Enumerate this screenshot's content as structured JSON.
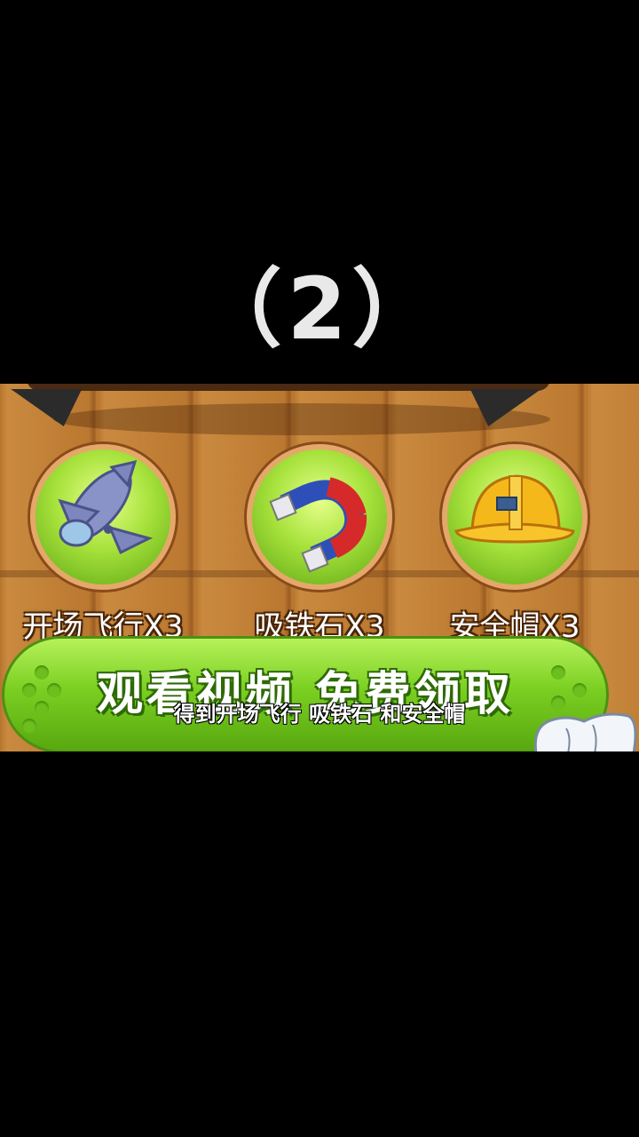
{
  "step_label": "（2）",
  "items": [
    {
      "label": "开场飞行X3",
      "icon": "airplane-icon"
    },
    {
      "label": "吸铁石X3",
      "icon": "magnet-icon"
    },
    {
      "label": "安全帽X3",
      "icon": "helmet-icon"
    }
  ],
  "claim_button": {
    "label": "观看视频 免费领取"
  },
  "subtitle": "得到开场飞行 吸铁石 和安全帽",
  "colors": {
    "button_green": "#7bcf22",
    "wood": "#c27f36",
    "orb_rim": "#e4a86a"
  }
}
